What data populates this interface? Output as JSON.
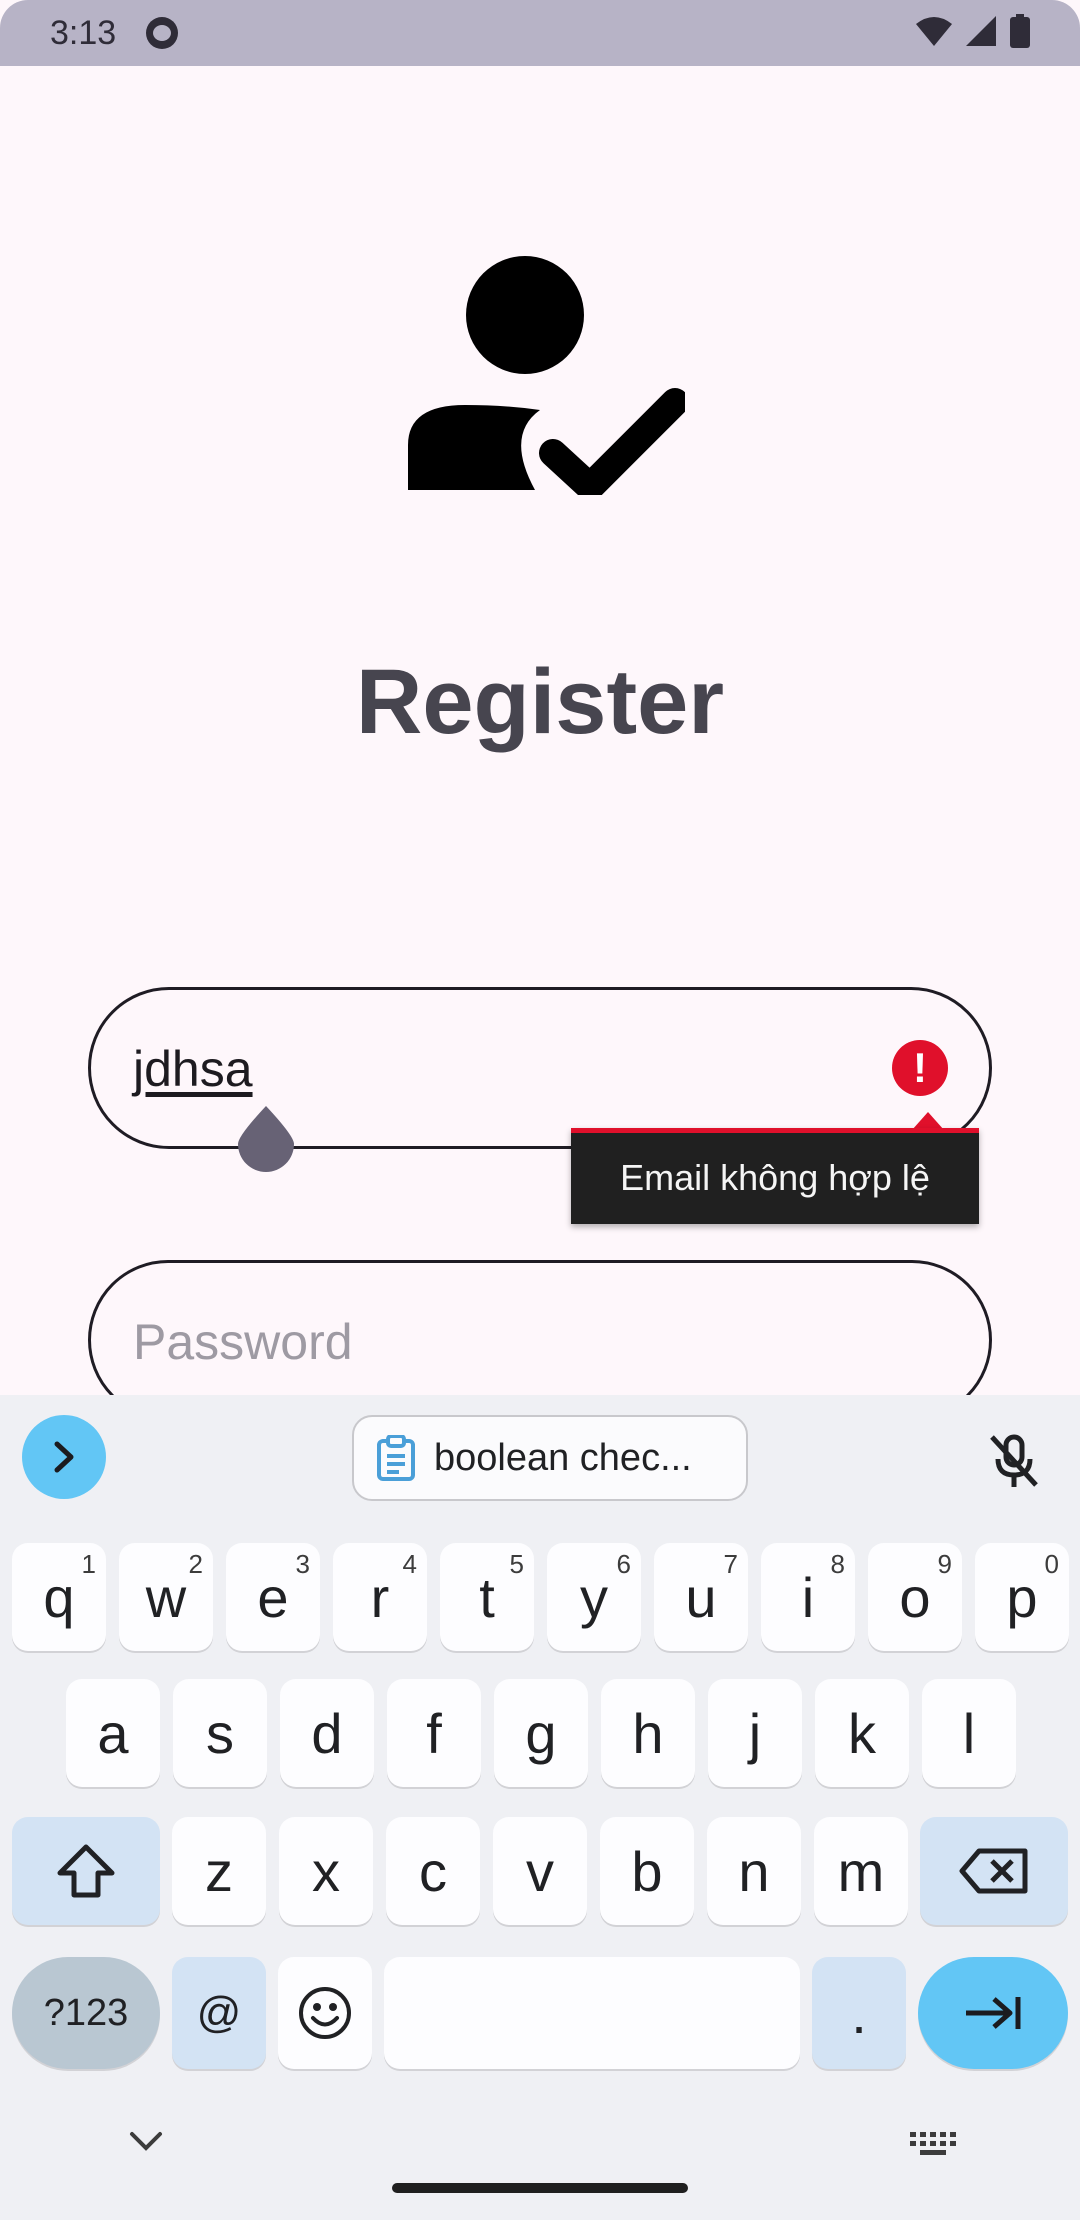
{
  "status_bar": {
    "time": "3:13"
  },
  "header": {
    "title": "Register"
  },
  "form": {
    "email_value": "jdhsa",
    "email_error": "Email không hợp lệ",
    "password_placeholder": "Password"
  },
  "keyboard": {
    "clipboard_suggestion": "boolean chec...",
    "rows": [
      [
        {
          "k": "q",
          "h": "1"
        },
        {
          "k": "w",
          "h": "2"
        },
        {
          "k": "e",
          "h": "3"
        },
        {
          "k": "r",
          "h": "4"
        },
        {
          "k": "t",
          "h": "5"
        },
        {
          "k": "y",
          "h": "6"
        },
        {
          "k": "u",
          "h": "7"
        },
        {
          "k": "i",
          "h": "8"
        },
        {
          "k": "o",
          "h": "9"
        },
        {
          "k": "p",
          "h": "0"
        }
      ],
      [
        {
          "k": "a"
        },
        {
          "k": "s"
        },
        {
          "k": "d"
        },
        {
          "k": "f"
        },
        {
          "k": "g"
        },
        {
          "k": "h"
        },
        {
          "k": "j"
        },
        {
          "k": "k"
        },
        {
          "k": "l"
        }
      ],
      [
        {
          "k": "z"
        },
        {
          "k": "x"
        },
        {
          "k": "c"
        },
        {
          "k": "v"
        },
        {
          "k": "b"
        },
        {
          "k": "n"
        },
        {
          "k": "m"
        }
      ]
    ],
    "symbols_label": "?123",
    "at_label": "@",
    "period_label": "."
  }
}
